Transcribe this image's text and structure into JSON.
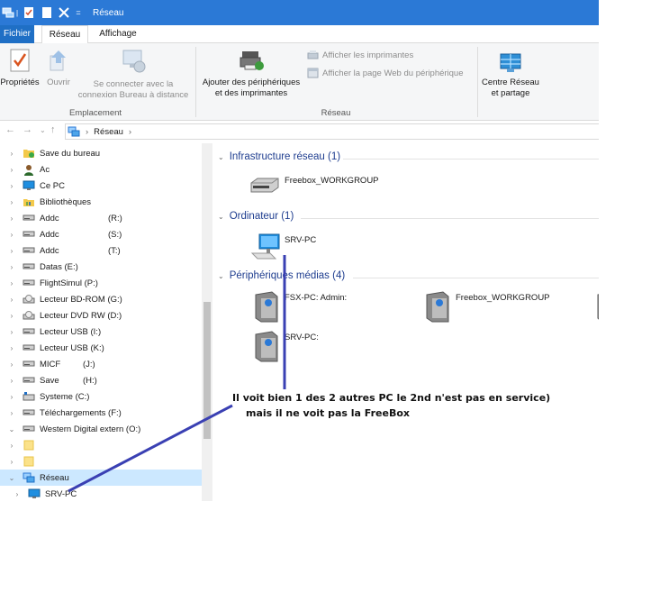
{
  "window": {
    "title": "Réseau"
  },
  "tabs": {
    "fichier": "Fichier",
    "reseau": "Réseau",
    "affichage": "Affichage"
  },
  "ribbon": {
    "proprietes": "Propriétés",
    "ouvrir": "Ouvrir",
    "connect_line1": "Se connecter avec la",
    "connect_line2": "connexion Bureau à distance",
    "group_emplacement": "Emplacement",
    "ajouter_line1": "Ajouter des périphériques",
    "ajouter_line2": "et des imprimantes",
    "afficher_imprimantes": "Afficher les imprimantes",
    "afficher_page_web": "Afficher la page Web du périphérique",
    "group_reseau": "Réseau",
    "centre_line1": "Centre Réseau",
    "centre_line2": "et partage"
  },
  "address": {
    "crumb": "Réseau"
  },
  "nav": {
    "items": [
      {
        "label": "Save du bureau",
        "expander": "›"
      },
      {
        "label": "Ac",
        "expander": "›"
      },
      {
        "label": "Ce PC",
        "expander": "›"
      },
      {
        "label": "Bibliothèques",
        "expander": "›"
      },
      {
        "label": "Addc",
        "drive": "(R:)",
        "expander": "›"
      },
      {
        "label": "Addc",
        "drive": "(S:)",
        "expander": "›"
      },
      {
        "label": "Addc",
        "drive": "(T:)",
        "expander": "›"
      },
      {
        "label": "Datas (E:)",
        "expander": "›"
      },
      {
        "label": "FlightSimul (P:)",
        "expander": "›"
      },
      {
        "label": "Lecteur BD-ROM (G:)",
        "expander": "›"
      },
      {
        "label": "Lecteur DVD RW (D:)",
        "expander": "›"
      },
      {
        "label": "Lecteur USB (I:)",
        "expander": "›"
      },
      {
        "label": "Lecteur USB (K:)",
        "expander": "›"
      },
      {
        "label": "MICF",
        "drive": "(J:)",
        "expander": "›"
      },
      {
        "label": "Save",
        "drive": "(H:)",
        "expander": "›"
      },
      {
        "label": "Systeme (C:)",
        "expander": "›"
      },
      {
        "label": "Téléchargements (F:)",
        "expander": "›"
      },
      {
        "label": "Western Digital extern (O:)",
        "expander": "⌄"
      },
      {
        "label": "",
        "expander": "›"
      },
      {
        "label": "",
        "expander": "›"
      },
      {
        "label": "Réseau",
        "expander": "⌄"
      },
      {
        "label": "SRV-PC",
        "expander": "›"
      }
    ]
  },
  "content": {
    "groups": [
      {
        "header": "Infrastructure réseau (1)",
        "items": [
          "Freebox_WORKGROUP"
        ]
      },
      {
        "header": "Ordinateur (1)",
        "items": [
          "SRV-PC"
        ]
      },
      {
        "header": "Périphériques médias (4)",
        "items": [
          "FSX-PC: Admin:",
          "Freebox_WORKGROUP",
          "SRV-PC:"
        ]
      }
    ]
  },
  "annotation": {
    "line1": "Il voit bien 1 des 2 autres PC le 2nd n'est pas en service)",
    "line2": "mais il ne voit pas la FreeBox"
  },
  "colors": {
    "titlebar": "#2b79d6",
    "selected": "#cce8ff",
    "group_header": "#1e3d8f",
    "annotation_line": "#3a40b3"
  }
}
